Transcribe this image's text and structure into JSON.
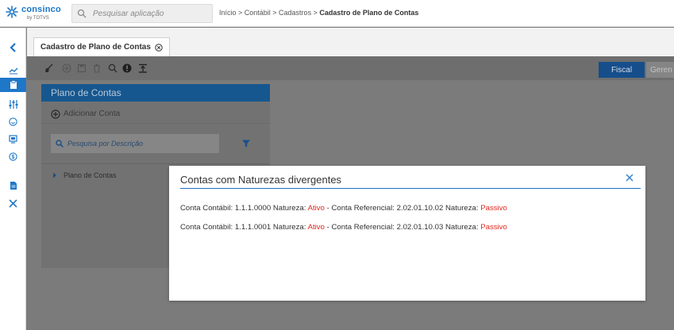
{
  "header": {
    "logo_text": "consinco",
    "logo_sub": "by TOTVS",
    "search_placeholder": "Pesquisar aplicação",
    "breadcrumb": {
      "path": "Início > Contábil > Cadastros > ",
      "current": "Cadastro de Plano de Contas"
    }
  },
  "rail": {
    "items": [
      {
        "icon": "chevron-left-icon"
      },
      {
        "icon": "chart-icon"
      },
      {
        "icon": "clipboard-icon",
        "active": true
      },
      {
        "icon": "sliders-icon"
      },
      {
        "icon": "smile-icon"
      },
      {
        "icon": "monitor-icon"
      },
      {
        "icon": "dollar-icon"
      },
      {
        "icon": "document-icon"
      },
      {
        "icon": "tools-icon"
      }
    ]
  },
  "tab": {
    "label": "Cadastro de Plano de Contas"
  },
  "toolbar": {
    "icons": [
      "broom-icon",
      "add-icon",
      "save-icon",
      "trash-icon",
      "search-icon",
      "info-icon",
      "export-icon"
    ],
    "fiscal_label": "Fiscal",
    "gerencial_label": "Geren"
  },
  "panel": {
    "title": "Plano de Contas",
    "add_label": "Adicionar Conta",
    "search_placeholder": "Pesquisa por Descrição",
    "tree_item": "Plano de Contas"
  },
  "modal": {
    "title": "Contas com Naturezas divergentes",
    "rows": [
      {
        "label_conta": "Conta Contábil:",
        "conta": "1.1.1.0000",
        "label_natureza": "Natureza:",
        "natureza": "Ativo",
        "sep": " - ",
        "label_ref": "Conta Referencial:",
        "ref": "2.02.01.10.02",
        "label_natureza_ref": "Natureza:",
        "natureza_ref": "Passivo"
      },
      {
        "label_conta": "Conta Contábil:",
        "conta": "1.1.1.0001",
        "label_natureza": "Natureza:",
        "natureza": "Ativo",
        "sep": " - ",
        "label_ref": "Conta Referencial:",
        "ref": "2.02.01.10.03",
        "label_natureza_ref": "Natureza:",
        "natureza_ref": "Passivo"
      }
    ]
  },
  "colors": {
    "accent": "#1f77c8",
    "panel_header": "#17578f",
    "fiscal_button": "#164e8c",
    "warning_red": "#e0281f"
  }
}
